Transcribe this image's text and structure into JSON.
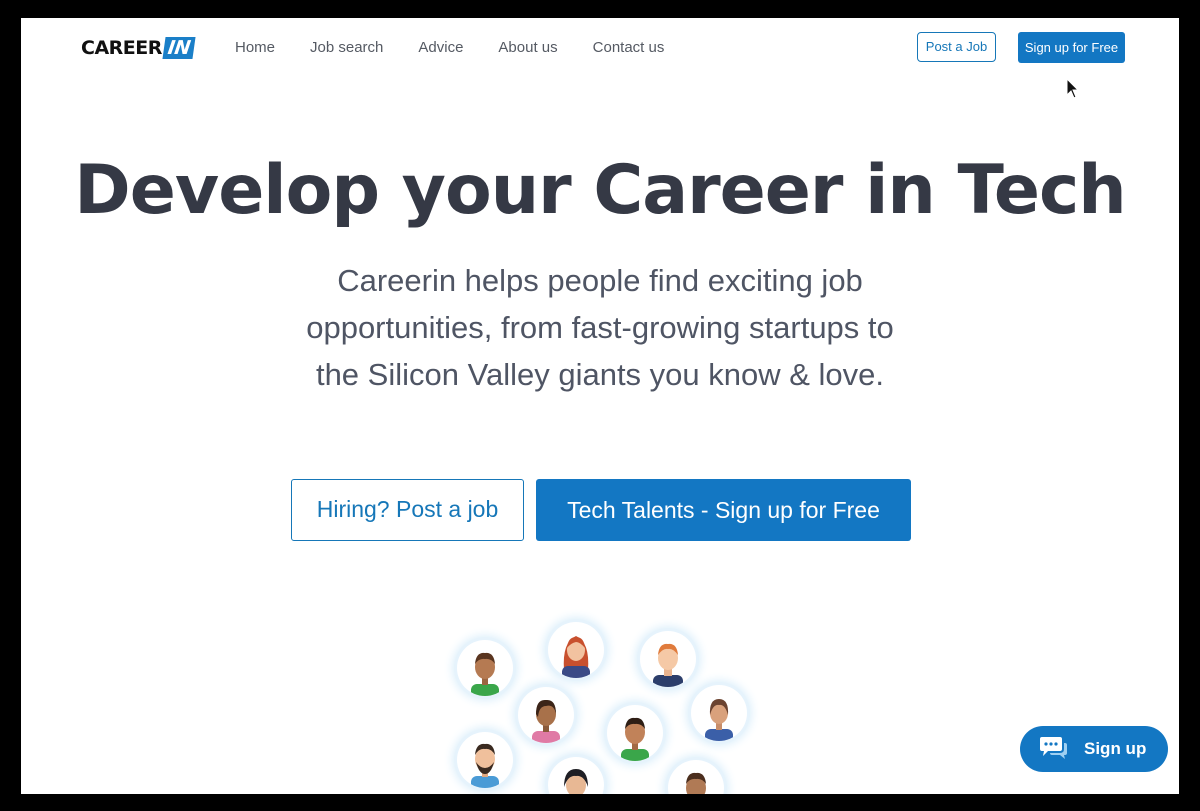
{
  "header": {
    "logo_text": "CAREER",
    "logo_badge": "IN",
    "nav": [
      "Home",
      "Job search",
      "Advice",
      "About us",
      "Contact us"
    ],
    "post_job_label": "Post a Job",
    "signup_label": "Sign up for Free"
  },
  "hero": {
    "title": "Develop your Career in Tech",
    "subtitle": "Careerin helps people find exciting job opportunities, from fast-growing startups to the Silicon Valley giants you know & love.",
    "hiring_button": "Hiring? Post a job",
    "talents_button": "Tech Talents - Sign up for Free"
  },
  "chat": {
    "label": "Sign up",
    "icon": "chat-bubble-icon"
  },
  "colors": {
    "accent": "#1377c3",
    "title": "#353945",
    "text": "#4f5564"
  }
}
